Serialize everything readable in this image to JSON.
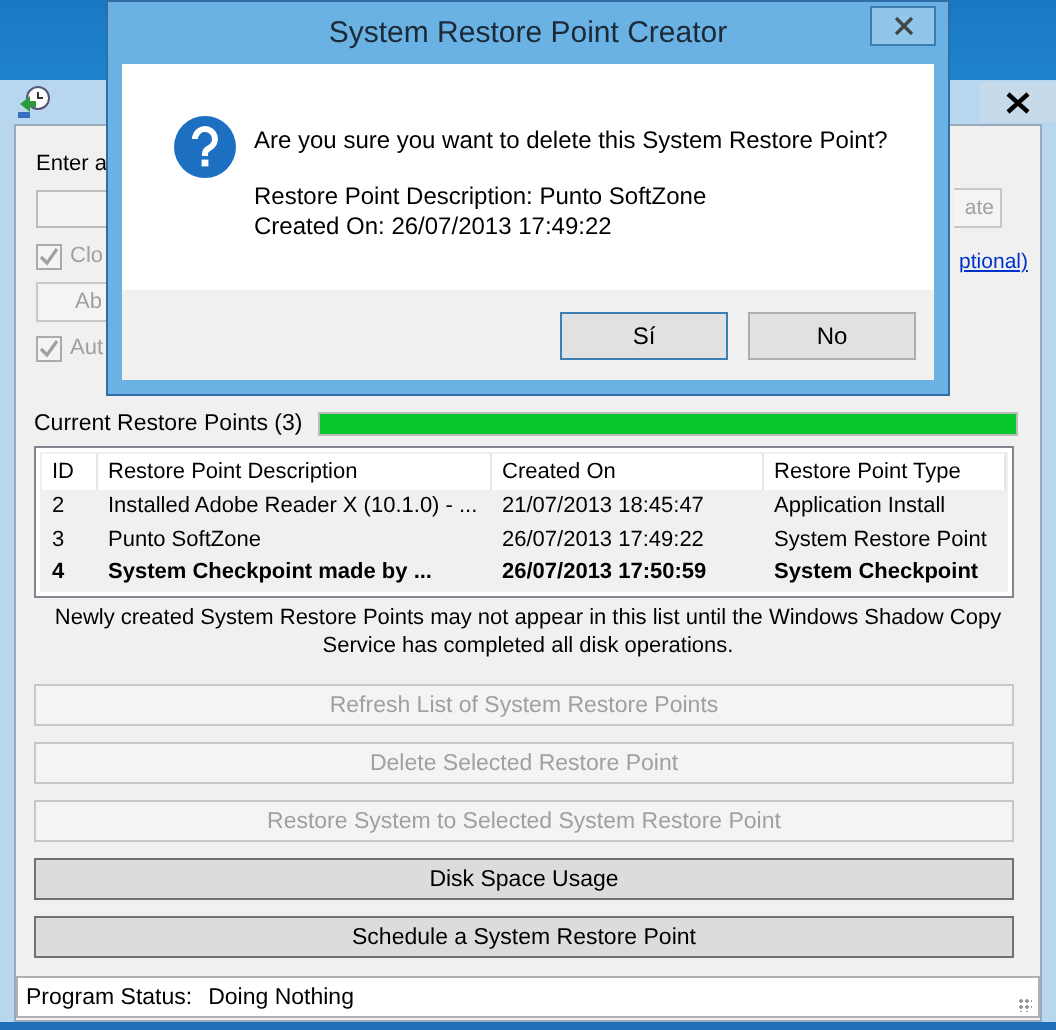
{
  "main_window": {
    "create_section": {
      "label": "Enter a",
      "create_button": {
        "label": "ate",
        "disabled": true
      },
      "close_checkbox": {
        "label": "Clo",
        "checked": true,
        "disabled": true
      },
      "optional_link": "ptional)",
      "about_button": {
        "label": "Ab",
        "disabled": true
      },
      "auto_checkbox": {
        "label": "Aut",
        "checked": true,
        "disabled": true
      }
    },
    "restore_points": {
      "label": "Current Restore Points (3)",
      "progress": {
        "level": 1
      },
      "columns": [
        "ID",
        "Restore Point Description",
        "Created On",
        "Restore Point Type"
      ],
      "rows": [
        {
          "id": "2",
          "description": "Installed Adobe Reader X (10.1.0) - ...",
          "created_on": "21/07/2013 18:45:47",
          "type": "Application Install",
          "bold": false
        },
        {
          "id": "3",
          "description": "Punto SoftZone",
          "created_on": "26/07/2013 17:49:22",
          "type": "System Restore Point",
          "bold": false
        },
        {
          "id": "4",
          "description": "System Checkpoint made by ...",
          "created_on": "26/07/2013 17:50:59",
          "type": "System Checkpoint",
          "bold": true
        }
      ]
    },
    "note": "Newly created System Restore Points may not appear in this list until the Windows Shadow Copy Service has completed all disk operations.",
    "buttons": [
      {
        "label": "Refresh List of System Restore Points",
        "disabled": true
      },
      {
        "label": "Delete Selected Restore Point",
        "disabled": true
      },
      {
        "label": "Restore System to Selected System Restore Point",
        "disabled": true
      },
      {
        "label": "Disk Space Usage",
        "disabled": false
      },
      {
        "label": "Schedule a System Restore Point",
        "disabled": false
      }
    ],
    "status_bar": {
      "label": "Program Status:",
      "value": "Doing Nothing"
    }
  },
  "dialog": {
    "title": "System Restore Point Creator",
    "question": "Are you sure you want to delete this System Restore Point?",
    "details": [
      "Restore Point Description: Punto SoftZone",
      "Created On: 26/07/2013 17:49:22"
    ],
    "buttons": [
      {
        "label": "Sí",
        "selected": true
      },
      {
        "label": "No",
        "selected": false
      }
    ]
  }
}
